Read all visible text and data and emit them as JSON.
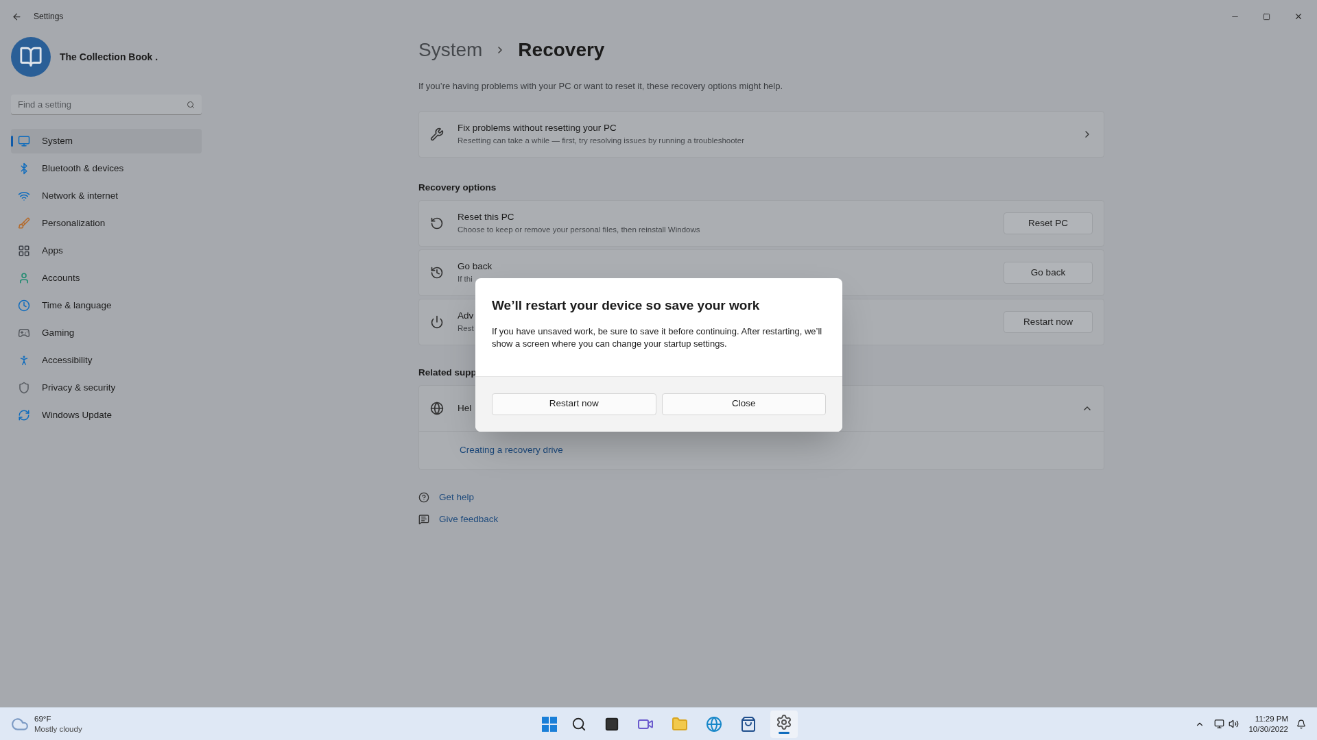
{
  "window": {
    "title": "Settings"
  },
  "profile": {
    "name": "The Collection Book ."
  },
  "search": {
    "placeholder": "Find a setting"
  },
  "sidebar": {
    "items": [
      {
        "label": "System",
        "selected": true
      },
      {
        "label": "Bluetooth & devices",
        "selected": false
      },
      {
        "label": "Network & internet",
        "selected": false
      },
      {
        "label": "Personalization",
        "selected": false
      },
      {
        "label": "Apps",
        "selected": false
      },
      {
        "label": "Accounts",
        "selected": false
      },
      {
        "label": "Time & language",
        "selected": false
      },
      {
        "label": "Gaming",
        "selected": false
      },
      {
        "label": "Accessibility",
        "selected": false
      },
      {
        "label": "Privacy & security",
        "selected": false
      },
      {
        "label": "Windows Update",
        "selected": false
      }
    ]
  },
  "breadcrumb": [
    "System",
    "Recovery"
  ],
  "intro": "If you’re having problems with your PC or want to reset it, these recovery options might help.",
  "fix_card": {
    "title": "Fix problems without resetting your PC",
    "description": "Resetting can take a while — first, try resolving issues by running a troubleshooter"
  },
  "recovery_options": {
    "heading": "Recovery options",
    "items": [
      {
        "title": "Reset this PC",
        "description": "Choose to keep or remove your personal files, then reinstall Windows",
        "button": "Reset PC"
      },
      {
        "title": "Go back",
        "description": "If thi",
        "button": "Go back"
      },
      {
        "title": "Adv",
        "description": "Rest",
        "button": "Restart now"
      }
    ]
  },
  "related_support": {
    "heading": "Related supp",
    "title": "Hel",
    "expanded": true,
    "link": "Creating a recovery drive"
  },
  "help_links": [
    "Get help",
    "Give feedback"
  ],
  "dialog": {
    "title": "We’ll restart your device so save your work",
    "body": "If you have unsaved work, be sure to save it before continuing. After restarting, we’ll show a screen where you can change your startup settings.",
    "buttons": [
      "Restart now",
      "Close"
    ]
  },
  "taskbar": {
    "weather": {
      "temperature": "69°F",
      "condition": "Mostly cloudy"
    },
    "clock": {
      "time": "11:29 PM",
      "date": "10/30/2022"
    }
  }
}
